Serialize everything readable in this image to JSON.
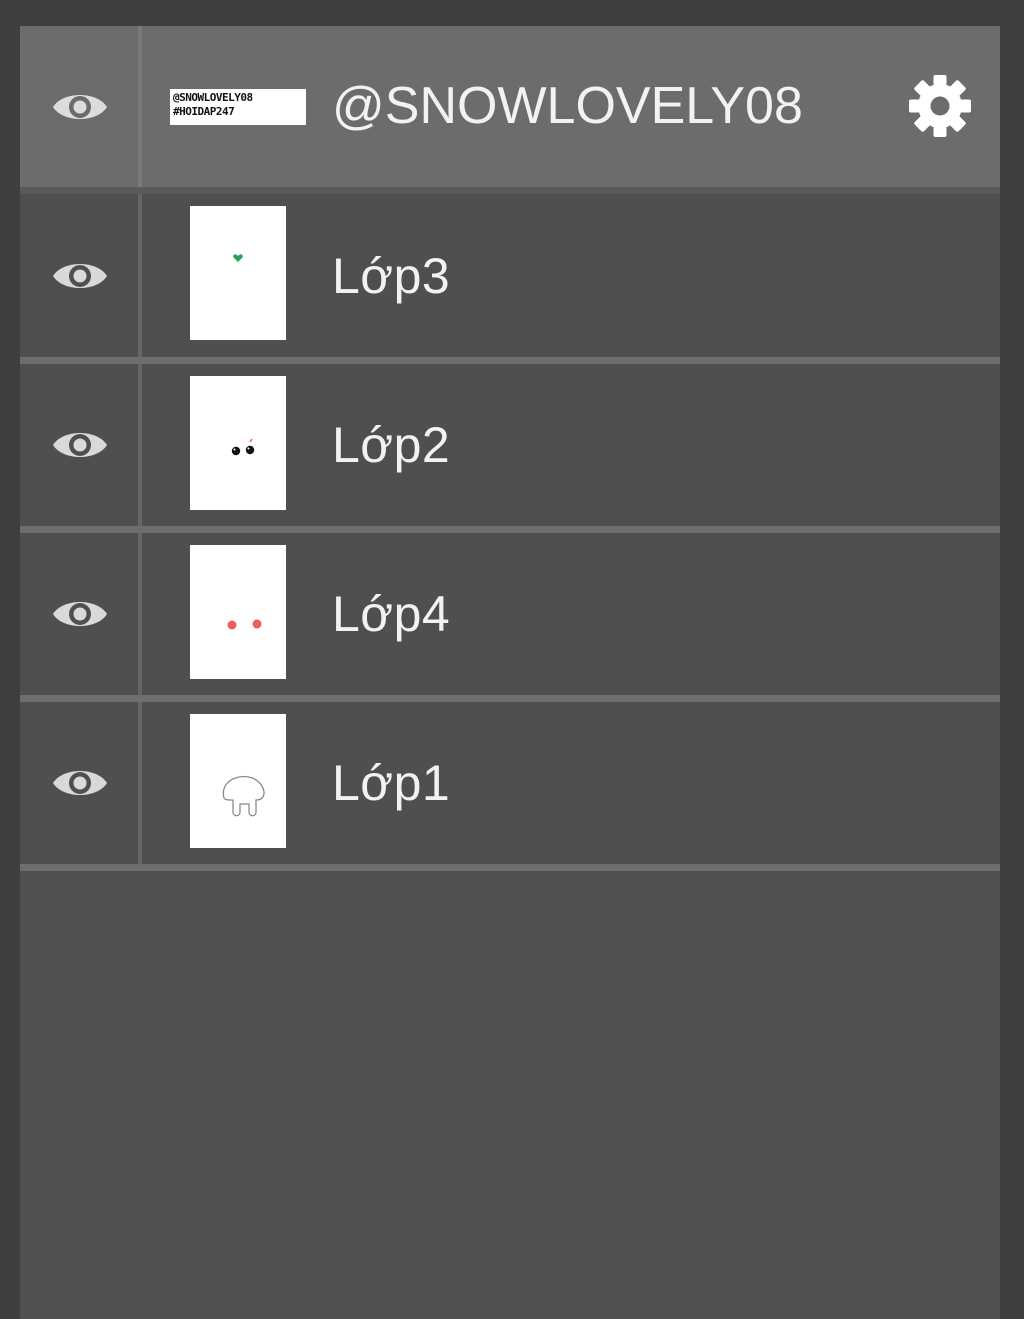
{
  "header": {
    "stamp_line1": "@SNOWLOVELY08",
    "stamp_line2": "#HOIDAP247",
    "title": "@SNOWLOVELY08",
    "settings_icon": "gear-icon",
    "visibility_icon": "eye-icon"
  },
  "layers": [
    {
      "name": "Lớp3",
      "thumbnail": "green-heart-mark"
    },
    {
      "name": "Lớp2",
      "thumbnail": "black-eyes-mark"
    },
    {
      "name": "Lớp4",
      "thumbnail": "red-cheeks-mark"
    },
    {
      "name": "Lớp1",
      "thumbnail": "mushroom-outline"
    }
  ],
  "colors": {
    "background": "#3f3f3f",
    "panel": "#505050",
    "header_row": "#6c6c6c",
    "layer_row": "#4f4f4f",
    "divider": "#6e6e6e",
    "text": "#f2f2f2",
    "icon": "#d9d9d9"
  }
}
